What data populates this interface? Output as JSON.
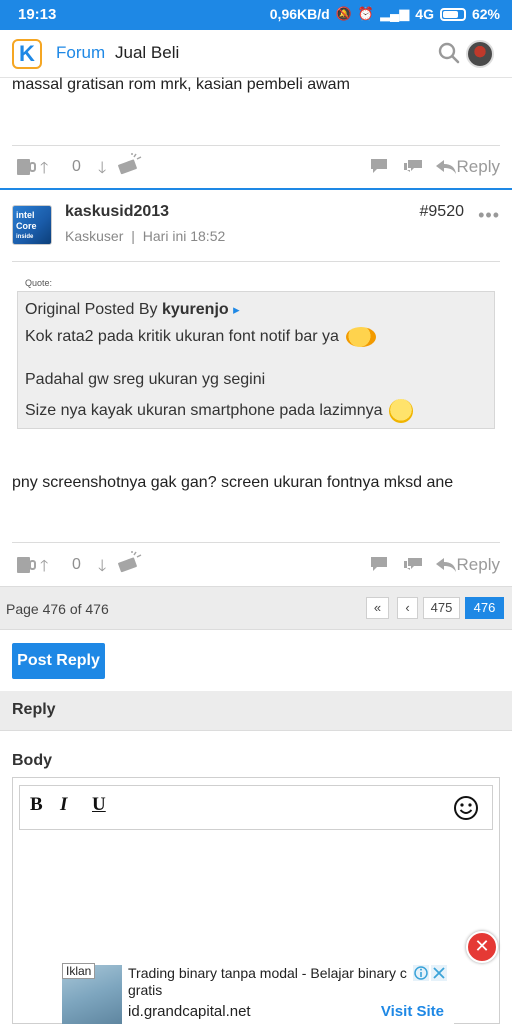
{
  "status_bar": {
    "time": "19:13",
    "net_speed": "0,96KB/d",
    "network": "4G",
    "battery": "62%"
  },
  "header": {
    "forum": "Forum",
    "subforum": "Jual Beli"
  },
  "previous_post": {
    "text": "massal gratisan rom mrk, kasian pembeli awam",
    "vote_count": "0",
    "reply_label": "Reply"
  },
  "post": {
    "author": "kaskusid2013",
    "role": "Kaskuser",
    "separator": "|",
    "time": "Hari ini 18:52",
    "number": "#9520",
    "more": "•••",
    "avatar_text": [
      "intel",
      "Core",
      "inside"
    ],
    "quote": {
      "label": "Quote:",
      "intro": "Original Posted By",
      "quoted_author": "kyurenjo",
      "lines": [
        "Kok rata2 pada kritik ukuran font notif bar ya",
        "Padahal gw sreg ukuran yg segini",
        "Size nya kayak ukuran smartphone pada lazimnya"
      ]
    },
    "text": "pny screenshotnya gak gan? screen ukuran fontnya mksd ane",
    "vote_count": "0",
    "reply_label": "Reply"
  },
  "pagination": {
    "info": "Page 476 of 476",
    "first": "«",
    "prev": "‹",
    "pages": [
      "475",
      "476"
    ],
    "current": "476"
  },
  "post_reply_button": "Post Reply",
  "reply_section": {
    "title": "Reply",
    "body_label": "Body",
    "toolbar": {
      "bold": "B",
      "italic": "I",
      "underline": "U"
    }
  },
  "ad": {
    "tag": "Iklan",
    "title": "Trading binary tanpa modal - Belajar binary c",
    "title_line2": "gratis",
    "domain": "id.grandcapital.net",
    "cta": "Visit Site"
  },
  "colors": {
    "primary": "#1e88e5",
    "close": "#e53935",
    "pager_bg": "#ececec"
  }
}
